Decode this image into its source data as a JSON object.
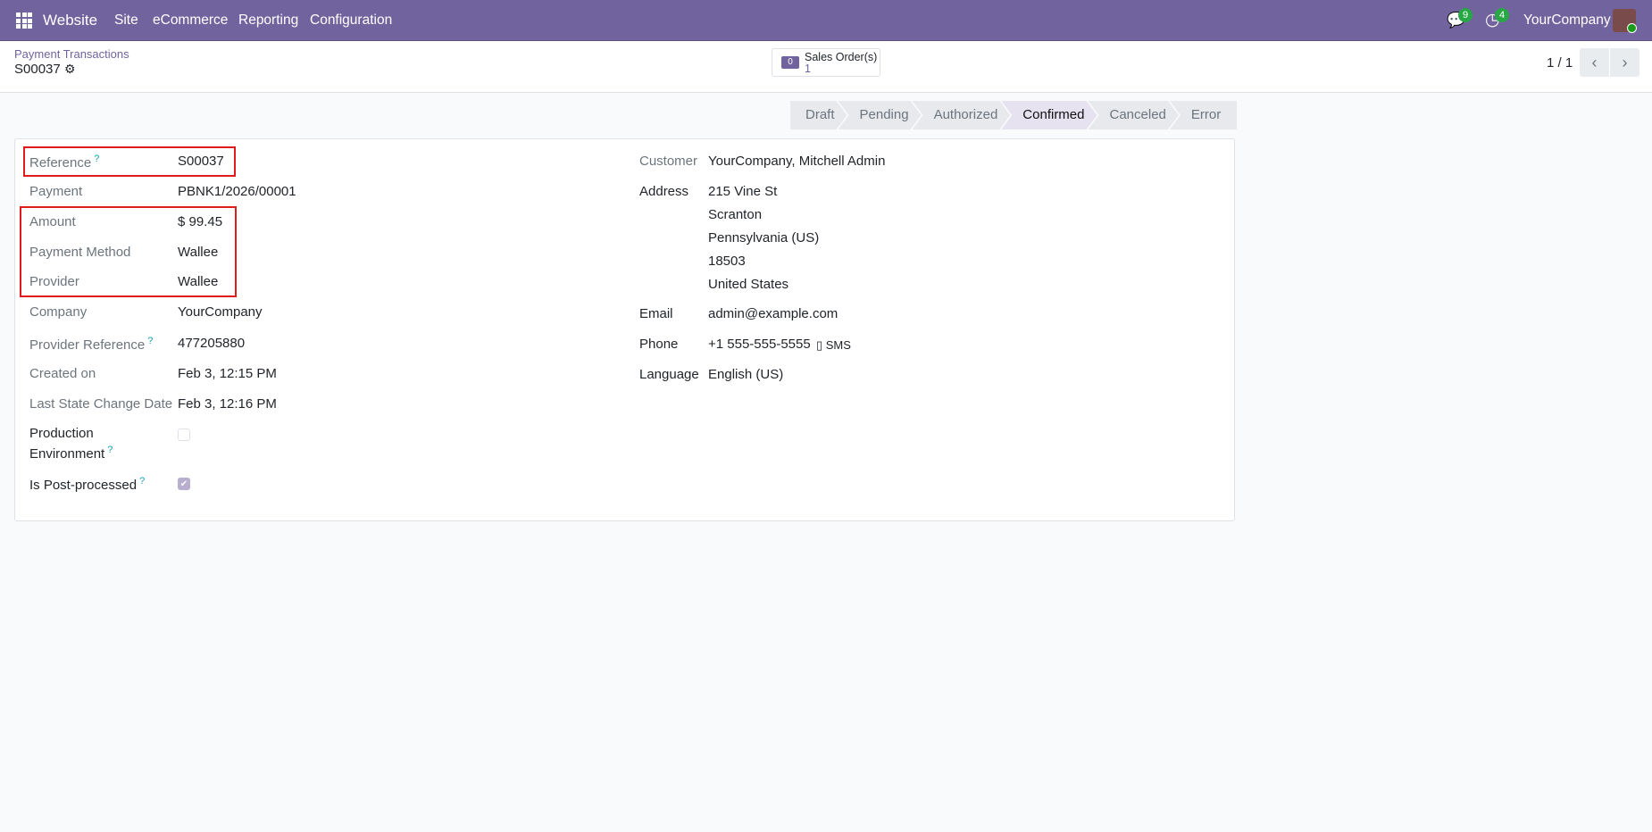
{
  "navbar": {
    "app": "Website",
    "menus": [
      "Site",
      "eCommerce",
      "Reporting",
      "Configuration"
    ],
    "messages_count": "9",
    "activities_count": "4",
    "company": "YourCompany"
  },
  "control": {
    "breadcrumb": "Payment Transactions",
    "title": "S00037",
    "smart_button": {
      "label": "Sales Order(s)",
      "count": "1"
    },
    "pager": "1 / 1"
  },
  "stages": [
    "Draft",
    "Pending",
    "Authorized",
    "Confirmed",
    "Canceled",
    "Error"
  ],
  "active_stage": "Confirmed",
  "left": {
    "reference": {
      "label": "Reference",
      "value": "S00037"
    },
    "payment": {
      "label": "Payment",
      "value": "PBNK1/2026/00001"
    },
    "amount": {
      "label": "Amount",
      "value": "$ 99.45"
    },
    "payment_method": {
      "label": "Payment Method",
      "value": "Wallee"
    },
    "provider": {
      "label": "Provider",
      "value": "Wallee"
    },
    "company": {
      "label": "Company",
      "value": "YourCompany"
    },
    "provider_reference": {
      "label": "Provider Reference",
      "value": "477205880"
    },
    "created_on": {
      "label": "Created on",
      "value": "Feb 3, 12:15 PM"
    },
    "last_state_change": {
      "label": "Last State Change Date",
      "value": "Feb 3, 12:16 PM"
    },
    "production_env": {
      "label1": "Production",
      "label2": "Environment",
      "checked": false
    },
    "post_processed": {
      "label": "Is Post-processed",
      "checked": true
    }
  },
  "right": {
    "customer": {
      "label": "Customer",
      "value": "YourCompany, Mitchell Admin"
    },
    "address": {
      "label": "Address",
      "lines": [
        "215 Vine St",
        "Scranton",
        "Pennsylvania (US)",
        "18503",
        "United States"
      ]
    },
    "email": {
      "label": "Email",
      "value": "admin@example.com"
    },
    "phone": {
      "label": "Phone",
      "value": "+1 555-555-5555",
      "sms": "SMS"
    },
    "language": {
      "label": "Language",
      "value": "English (US)"
    }
  },
  "help_mark": "?"
}
